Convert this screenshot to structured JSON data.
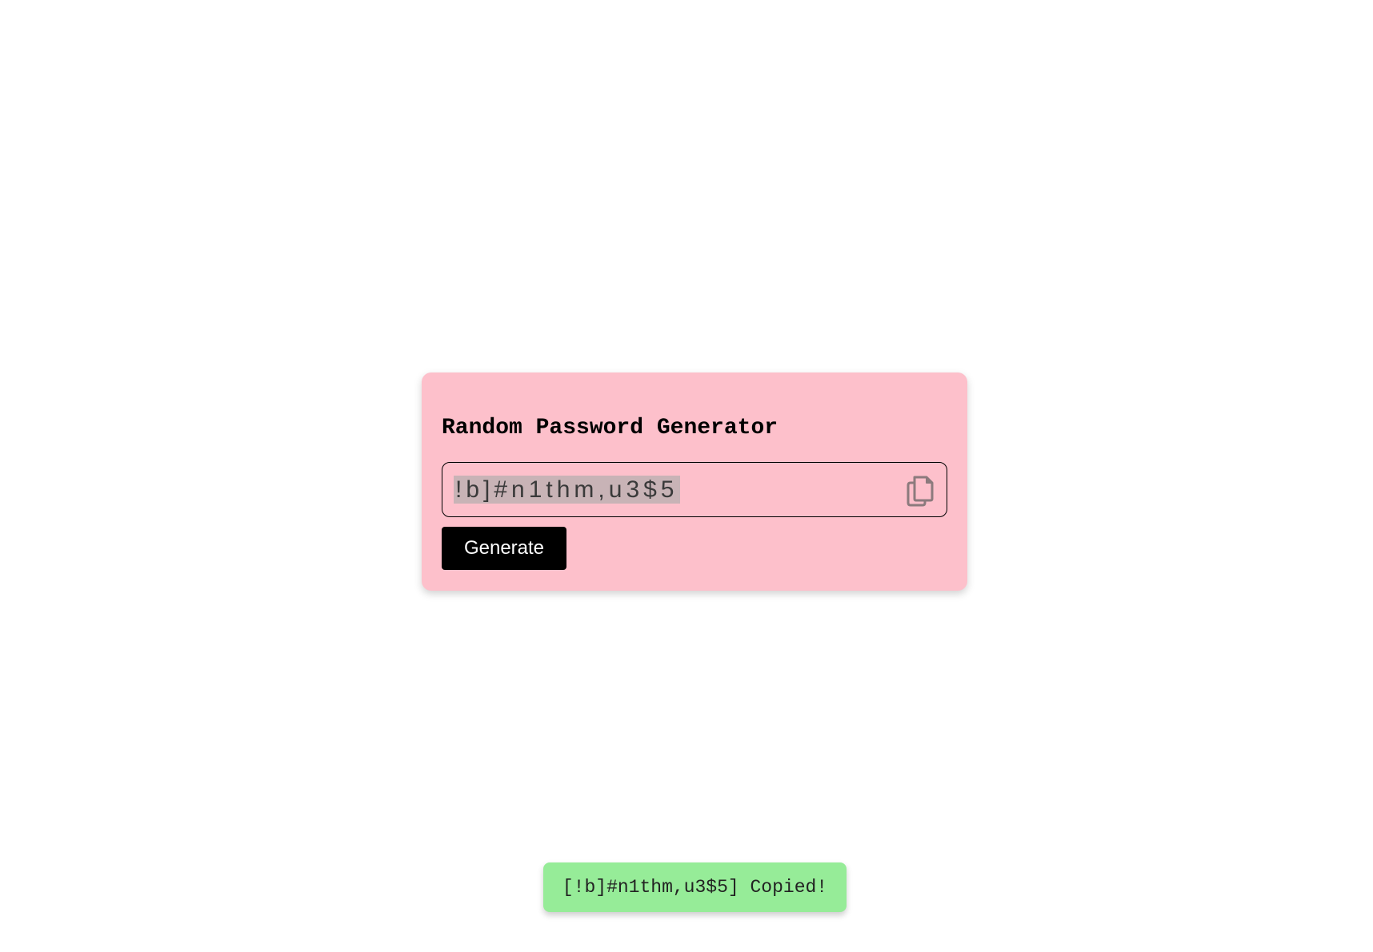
{
  "card": {
    "title": "Random Password Generator",
    "password": "!b]#n1thm,u3$5",
    "copy_icon": "copy-icon",
    "generate_label": "Generate"
  },
  "toast": {
    "message": "[!b]#n1thm,u3$5] Copied!"
  },
  "colors": {
    "card_background": "#fdc0cb",
    "toast_background": "#96ec98",
    "button_background": "#000000",
    "selection_highlight": "#c8b3b6"
  }
}
